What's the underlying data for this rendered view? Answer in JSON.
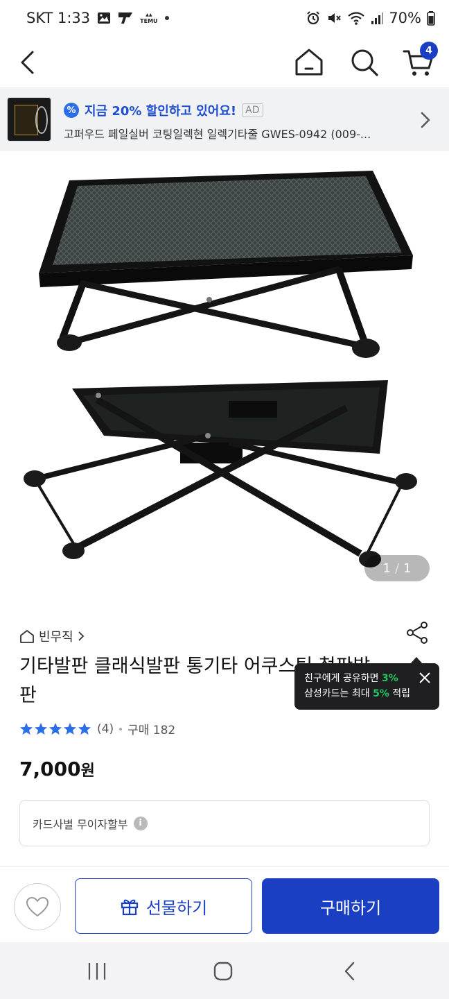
{
  "status_bar": {
    "carrier_time": "SKT 1:33",
    "notification_icons": [
      "image-icon",
      "tving-icon",
      "temu-icon"
    ],
    "temu_label": "TEMU",
    "battery": "70%"
  },
  "top_nav": {
    "cart_count": "4"
  },
  "ad_banner": {
    "headline": "지금 20% 할인하고 있어요!",
    "ad_tag": "AD",
    "product_name": "고퍼우드 페일실버 코팅일렉현 일렉기타줄 GWES-0942  (009-..."
  },
  "product_image": {
    "counter_current": "1",
    "counter_sep": "/",
    "counter_total": "1"
  },
  "product": {
    "brand": "빈무직",
    "title": "기타발판 클래식발판 통기타 어쿠스틱 철판발판",
    "rating_stars": 5,
    "review_count": "(4)",
    "purchase_label": "구매 182",
    "price": "7,000",
    "currency": "원",
    "installment_label": "카드사별 무이자할부",
    "info_glyph": "i"
  },
  "share_tooltip": {
    "line1_prefix": "친구에게 공유하면 ",
    "line1_highlight": "3%",
    "line2_prefix": "삼성카드는 최대 ",
    "line2_highlight": "5%",
    "line2_suffix": " 적립"
  },
  "bottom_bar": {
    "gift_label": "선물하기",
    "buy_label": "구매하기"
  },
  "colors": {
    "primary": "#1a3fc2",
    "ad_text": "#1f4fd1",
    "star": "#2b6ee6",
    "highlight_green": "#22c55e"
  }
}
